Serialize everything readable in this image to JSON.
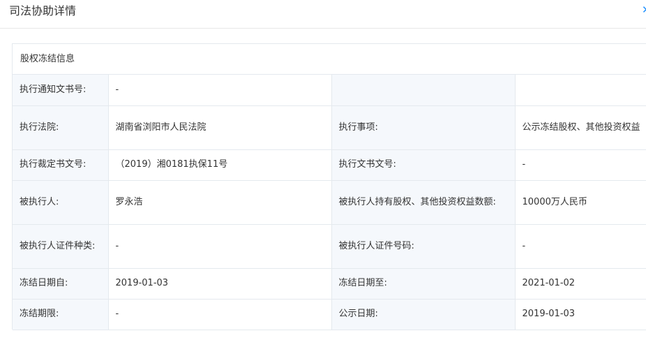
{
  "header": {
    "title": "司法协助详情",
    "close_icon": "close-icon"
  },
  "panel": {
    "title": "股权冻结信息"
  },
  "rows": [
    {
      "label1": "执行通知文书号:",
      "value1": "-",
      "label2": "",
      "value2": ""
    },
    {
      "label1": "执行法院:",
      "value1": "湖南省浏阳市人民法院",
      "label2": "执行事项:",
      "value2": "公示冻结股权、其他投资权益"
    },
    {
      "label1": "执行裁定书文号:",
      "value1": "（2019）湘0181执保11号",
      "label2": "执行文书文号:",
      "value2": "-"
    },
    {
      "label1": "被执行人:",
      "value1": "罗永浩",
      "label2": "被执行人持有股权、其他投资权益数额:",
      "value2": "10000万人民币"
    },
    {
      "label1": "被执行人证件种类:",
      "value1": "-",
      "label2": "被执行人证件号码:",
      "value2": "-"
    },
    {
      "label1": "冻结日期自:",
      "value1": "2019-01-03",
      "label2": "冻结日期至:",
      "value2": "2021-01-02"
    },
    {
      "label1": "冻结期限:",
      "value1": "-",
      "label2": "公示日期:",
      "value2": "2019-01-03"
    }
  ]
}
